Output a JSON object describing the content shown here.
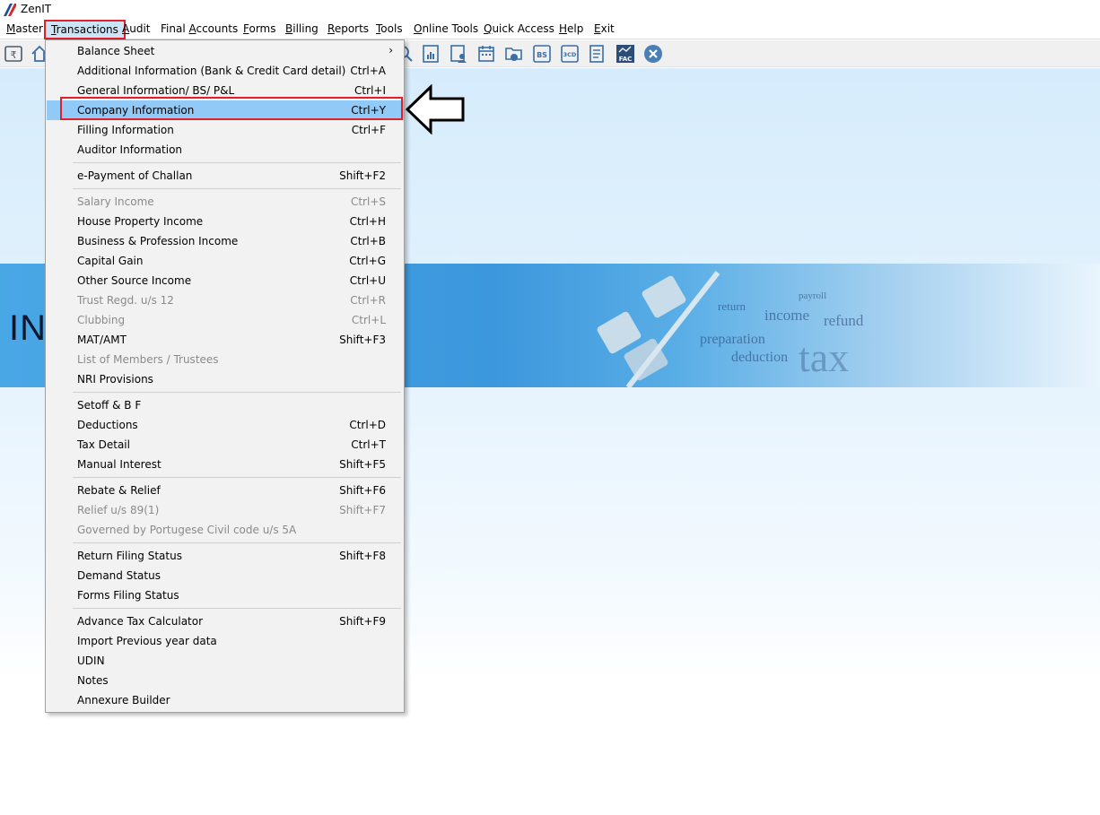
{
  "window": {
    "title": "ZenIT"
  },
  "menubar": {
    "items": [
      {
        "label": "Master"
      },
      {
        "label": "Transactions"
      },
      {
        "label": "Audit"
      },
      {
        "label": "Final Accounts"
      },
      {
        "label": "Forms"
      },
      {
        "label": "Billing"
      },
      {
        "label": "Reports"
      },
      {
        "label": "Tools"
      },
      {
        "label": "Online Tools"
      },
      {
        "label": "Quick Access"
      },
      {
        "label": "Help"
      },
      {
        "label": "Exit"
      }
    ],
    "active": "Transactions"
  },
  "toolbar": {
    "icons": [
      "rupee-icon",
      "home-icon",
      "search-icon",
      "report-icon",
      "user-form-icon",
      "calendar-icon",
      "folder-icon",
      "bs-icon",
      "3cd-icon",
      "document-icon",
      "fac-icon",
      "close-circle-icon"
    ],
    "labels": {
      "bs": "BS",
      "3cd": "3CD",
      "fac": "FAC"
    }
  },
  "banner": {
    "text": "INC",
    "words": [
      "income",
      "refund",
      "preparation",
      "deduction",
      "tax",
      "return",
      "payroll"
    ]
  },
  "dropdown": {
    "items": [
      {
        "label": "Balance Sheet",
        "shortcut": "",
        "submenu": true,
        "submenu_glyph": "›"
      },
      {
        "label": "Additional Information (Bank & Credit Card detail)",
        "shortcut": "Ctrl+A"
      },
      {
        "label": "General Information/ BS/ P&L",
        "shortcut": "Ctrl+I"
      },
      {
        "label": "Company Information",
        "shortcut": "Ctrl+Y",
        "highlighted": true
      },
      {
        "label": "Filling Information",
        "shortcut": "Ctrl+F"
      },
      {
        "label": "Auditor Information",
        "shortcut": ""
      },
      {
        "label": "e-Payment of Challan",
        "shortcut": "Shift+F2"
      },
      {
        "label": "Salary Income",
        "shortcut": "Ctrl+S",
        "disabled": true
      },
      {
        "label": "House Property Income",
        "shortcut": "Ctrl+H"
      },
      {
        "label": "Business & Profession Income",
        "shortcut": "Ctrl+B"
      },
      {
        "label": "Capital Gain",
        "shortcut": "Ctrl+G"
      },
      {
        "label": "Other Source Income",
        "shortcut": "Ctrl+U"
      },
      {
        "label": "Trust Regd. u/s 12",
        "shortcut": "Ctrl+R",
        "disabled": true
      },
      {
        "label": "Clubbing",
        "shortcut": "Ctrl+L",
        "disabled": true
      },
      {
        "label": "MAT/AMT",
        "shortcut": "Shift+F3"
      },
      {
        "label": "List of Members / Trustees",
        "shortcut": "",
        "disabled": true
      },
      {
        "label": "NRI Provisions",
        "shortcut": ""
      },
      {
        "label": "Setoff & B F",
        "shortcut": ""
      },
      {
        "label": "Deductions",
        "shortcut": "Ctrl+D"
      },
      {
        "label": "Tax Detail",
        "shortcut": "Ctrl+T"
      },
      {
        "label": "Manual Interest",
        "shortcut": "Shift+F5"
      },
      {
        "label": "Rebate & Relief",
        "shortcut": "Shift+F6"
      },
      {
        "label": "Relief u/s 89(1)",
        "shortcut": "Shift+F7",
        "disabled": true
      },
      {
        "label": "Governed by Portugese Civil code u/s 5A",
        "shortcut": "",
        "disabled": true
      },
      {
        "label": "Return Filing Status",
        "shortcut": "Shift+F8"
      },
      {
        "label": "Demand Status",
        "shortcut": ""
      },
      {
        "label": "Forms Filing Status",
        "shortcut": ""
      },
      {
        "label": "Advance Tax Calculator",
        "shortcut": "Shift+F9"
      },
      {
        "label": "Import Previous year data",
        "shortcut": ""
      },
      {
        "label": "UDIN",
        "shortcut": ""
      },
      {
        "label": "Notes",
        "shortcut": ""
      },
      {
        "label": "Annexure Builder",
        "shortcut": ""
      }
    ]
  },
  "colors": {
    "highlight": "#91c9f7",
    "annotation_red": "#e0202a",
    "disabled_text": "#8a8a8a"
  }
}
